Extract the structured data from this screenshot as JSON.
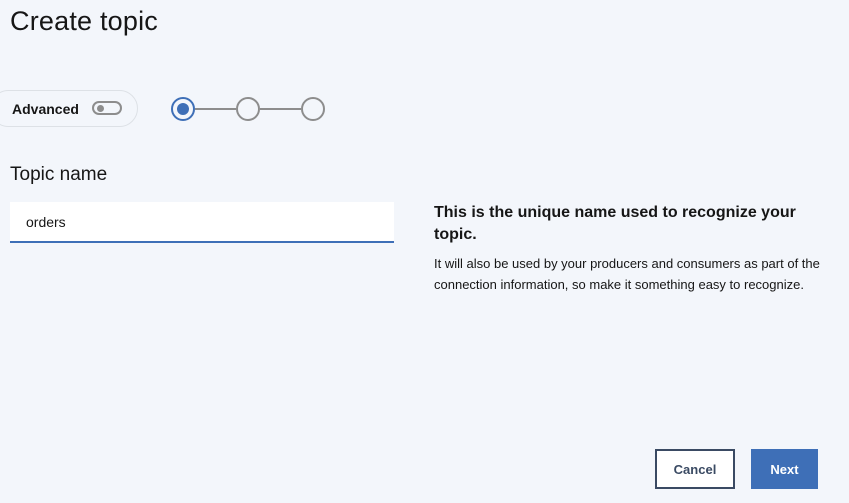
{
  "header": {
    "title": "Create topic"
  },
  "advanced": {
    "label": "Advanced",
    "enabled": false
  },
  "stepper": {
    "total_steps": 3,
    "current_step": 1
  },
  "topic_name": {
    "label": "Topic name",
    "value": "orders"
  },
  "help": {
    "title": "This is the unique name used to recognize your topic.",
    "body": "It will also be used by your producers and consumers as part of the connection information, so make it something easy to recognize."
  },
  "actions": {
    "cancel_label": "Cancel",
    "next_label": "Next"
  },
  "colors": {
    "accent": "#3e6fb7",
    "background": "#f3f6fb",
    "secondary_border": "#3a4a63",
    "inactive": "#8d8d8d"
  },
  "icons": {
    "toggle": "toggle-switch-off-icon",
    "step_active": "step-current-icon",
    "step_inactive": "step-incomplete-icon"
  }
}
